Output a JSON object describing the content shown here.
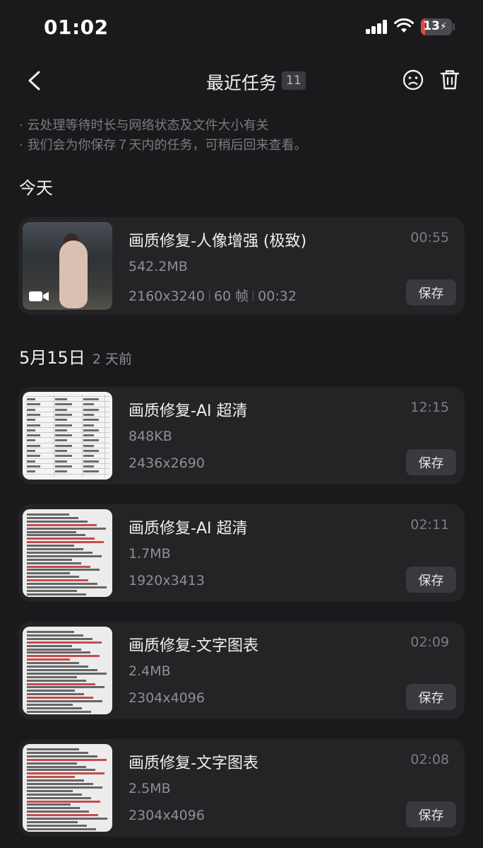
{
  "status_bar": {
    "time": "01:02",
    "battery": "13",
    "battery_level": 0.13
  },
  "nav": {
    "title": "最近任务",
    "count": "11"
  },
  "notes": [
    "· 云处理等待时长与网络状态及文件大小有关",
    "· 我们会为你保存７天内的任务，可稍后回来查看。"
  ],
  "sections": [
    {
      "title": "今天",
      "subtitle": ""
    },
    {
      "title": "5月15日",
      "subtitle": "2 天前"
    }
  ],
  "save_label": "保存",
  "tasks": [
    {
      "title": "画质修复-人像增强 (极致)",
      "time": "00:55",
      "size": "542.2MB",
      "resolution": "2160x3240",
      "fps": "60 帧",
      "duration": "00:32",
      "thumbnail": "video-thumbnail"
    },
    {
      "title": "画质修复-AI 超清",
      "time": "12:15",
      "size": "848KB",
      "resolution": "2436x2690",
      "thumbnail": "spreadsheet-thumbnail"
    },
    {
      "title": "画质修复-AI 超清",
      "time": "02:11",
      "size": "1.7MB",
      "resolution": "1920x3413",
      "thumbnail": "document-thumbnail"
    },
    {
      "title": "画质修复-文字图表",
      "time": "02:09",
      "size": "2.4MB",
      "resolution": "2304x4096",
      "thumbnail": "document-thumbnail"
    },
    {
      "title": "画质修复-文字图表",
      "time": "02:08",
      "size": "2.5MB",
      "resolution": "2304x4096",
      "thumbnail": "document-thumbnail"
    }
  ],
  "icons": {
    "back": "chevron-left-icon",
    "feedback": "sad-face-icon",
    "trash": "trash-icon",
    "video": "video-camera-icon",
    "signal": "signal-icon",
    "wifi": "wifi-icon",
    "battery": "battery-icon"
  },
  "colors": {
    "background": "#1a1a1c",
    "card": "#242427",
    "battery_low": "#e04848"
  }
}
